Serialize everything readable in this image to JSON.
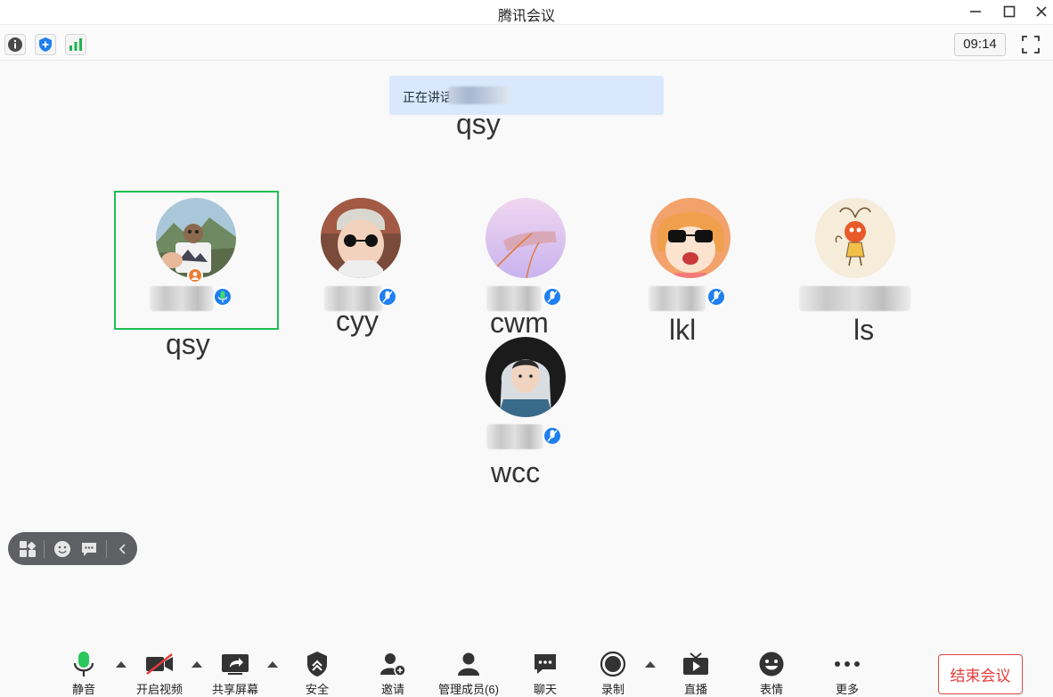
{
  "window": {
    "title": "腾讯会议"
  },
  "status": {
    "timer": "09:14"
  },
  "banner": {
    "speaking_label": "正在讲话",
    "speaking_caption": "qsy"
  },
  "participants": [
    {
      "caption": "qsy"
    },
    {
      "caption": "cyy"
    },
    {
      "caption": "cwm"
    },
    {
      "caption": "lkl"
    },
    {
      "caption": "ls"
    },
    {
      "caption": "wcc"
    }
  ],
  "toolbar": {
    "mute": "静音",
    "video": "开启视频",
    "share": "共享屏幕",
    "security": "安全",
    "invite": "邀请",
    "members": "管理成员(6)",
    "chat": "聊天",
    "record": "录制",
    "live": "直播",
    "emoji": "表情",
    "more": "更多",
    "end": "结束会议"
  },
  "colors": {
    "active_border": "#1fbf53",
    "accent_blue": "#1e7ff0",
    "end_red": "#e53b3b",
    "banner_bg": "#d9e8fc"
  }
}
